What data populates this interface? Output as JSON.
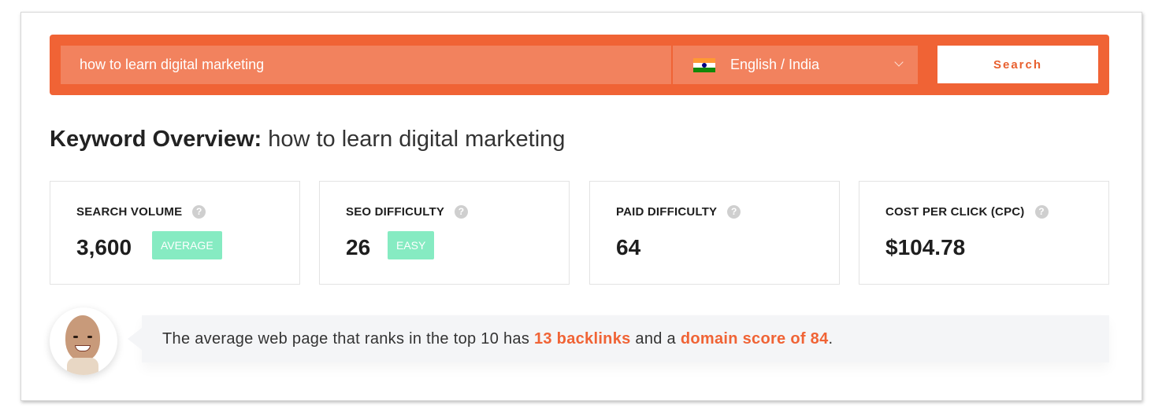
{
  "search": {
    "keyword_value": "how to learn digital marketing",
    "language_label": "English / India",
    "language_flag": "india-flag-icon",
    "search_button_label": "Search"
  },
  "overview": {
    "title_prefix": "Keyword Overview:",
    "title_keyword": "how to learn digital marketing"
  },
  "metrics": [
    {
      "label": "SEARCH VOLUME",
      "value": "3,600",
      "badge": "AVERAGE",
      "help_icon": "question-circle-icon"
    },
    {
      "label": "SEO DIFFICULTY",
      "value": "26",
      "badge": "EASY",
      "help_icon": "question-circle-icon"
    },
    {
      "label": "PAID DIFFICULTY",
      "value": "64",
      "help_icon": "question-circle-icon"
    },
    {
      "label": "COST PER CLICK (CPC)",
      "value": "$104.78",
      "help_icon": "question-circle-icon"
    }
  ],
  "insight": {
    "text_before": "The average web page that ranks in the top 10 has ",
    "backlinks": "13 backlinks",
    "text_middle": " and a ",
    "domain_score": "domain score of 84",
    "text_after": "."
  },
  "colors": {
    "brand_orange": "#f06335",
    "input_bg": "#f2825e",
    "badge_green": "#86ebc2",
    "help_grey": "#cfcfcf"
  }
}
